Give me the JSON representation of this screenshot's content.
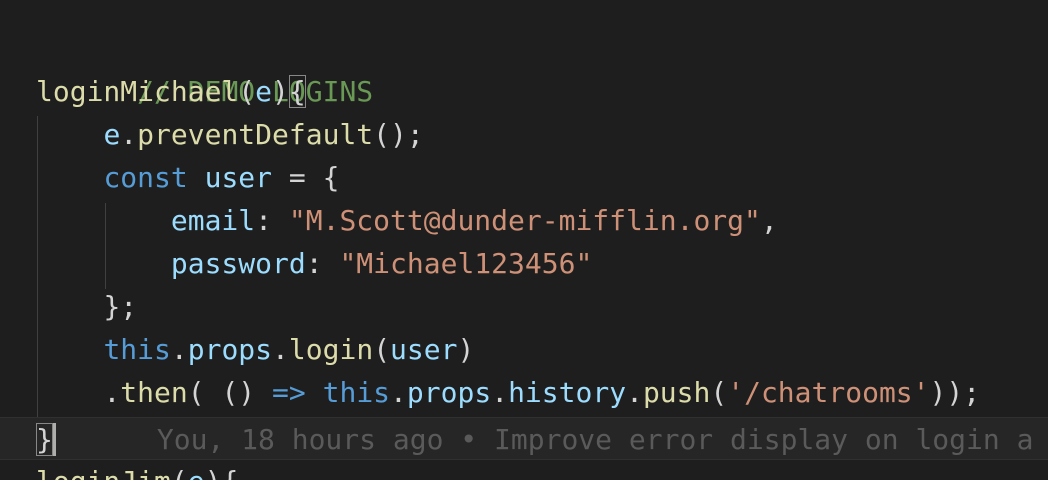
{
  "editor": {
    "lines": [
      {
        "comment": "// DEMO LOGINS"
      },
      {
        "fn_name": "loginMichael",
        "open_paren": "(",
        "param": "e",
        "close_paren": ")",
        "brace": "{"
      },
      {
        "obj": "e",
        "dot": ".",
        "method": "preventDefault",
        "call": "();"
      },
      {
        "keyword": "const",
        "var": "user",
        "assign": " = {"
      },
      {
        "key": "email",
        "colon": ": ",
        "value": "\"M.Scott@dunder-mifflin.org\"",
        "comma": ","
      },
      {
        "key": "password",
        "colon": ": ",
        "value": "\"Michael123456\""
      },
      {
        "text": "};"
      },
      {
        "this": "this",
        "dot1": ".",
        "prop1": "props",
        "dot2": ".",
        "method": "login",
        "open": "(",
        "arg": "user",
        "close": ")"
      },
      {
        "dot1": ".",
        "method": "then",
        "open": "( () ",
        "arrow": "=>",
        "this": "this",
        "dot2": ".",
        "prop1": "props",
        "dot3": ".",
        "prop2": "history",
        "dot4": ".",
        "method2": "push",
        "open2": "(",
        "arg": "'/chatrooms'",
        "close": "));"
      },
      {
        "brace": "}",
        "blame": "You, 18 hours ago • Improve error display on login a"
      },
      {
        "fn_name": "loginJim",
        "open_paren": "(",
        "param": "e",
        "close_paren": ")",
        "brace": "{"
      }
    ]
  },
  "colors": {
    "background": "#1e1e1e",
    "comment": "#6a9955",
    "function": "#dcdcaa",
    "keyword": "#569cd6",
    "variable": "#9cdcfe",
    "string": "#ce9178",
    "blame": "#5a5a5a"
  }
}
